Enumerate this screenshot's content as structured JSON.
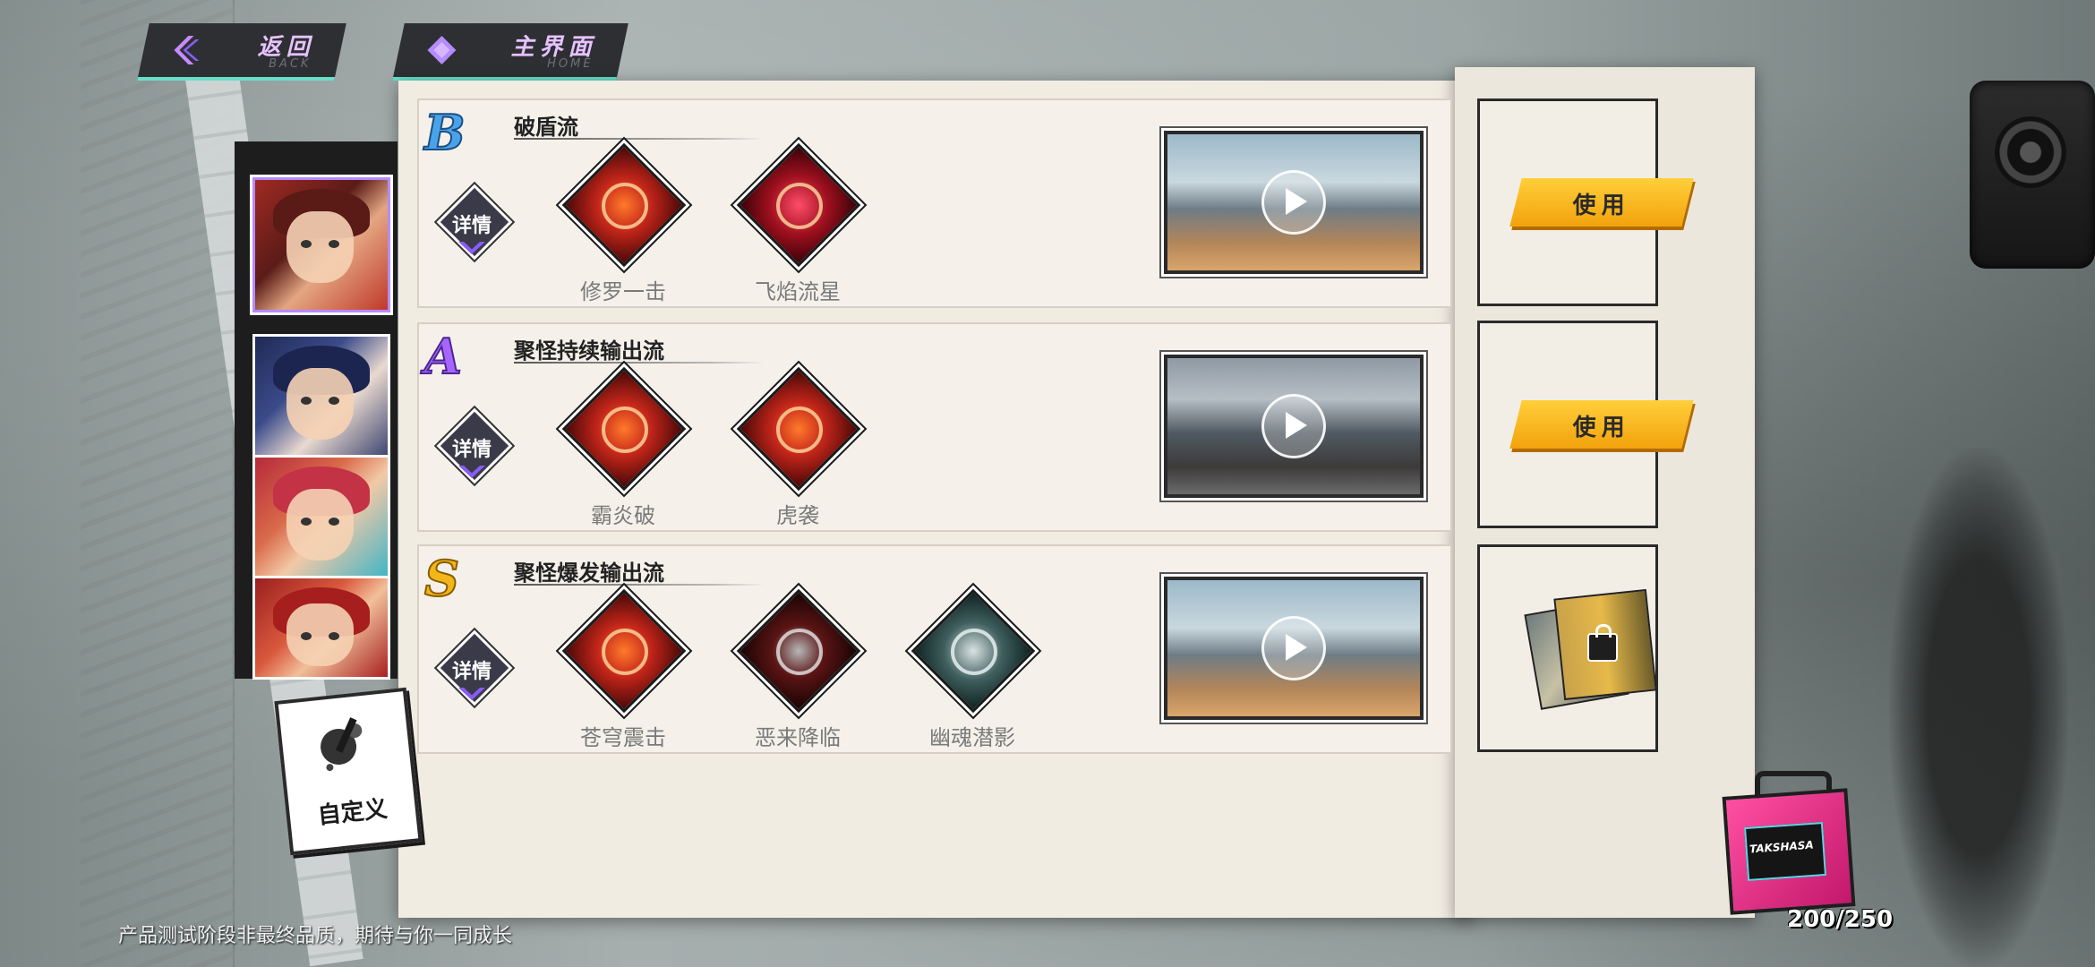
{
  "top_bar": {
    "back": {
      "label": "返回",
      "sub": "BACK"
    },
    "home": {
      "label": "主界面",
      "sub": "HOME"
    }
  },
  "custom_button": {
    "label": "自定义"
  },
  "builds": [
    {
      "rank": "B",
      "rank_color": "#4aa3e8",
      "title": "破盾流",
      "detail_label": "详情",
      "skills": [
        {
          "name": "修罗一击",
          "style": "red"
        },
        {
          "name": "飞焰流星",
          "style": "crimson"
        }
      ],
      "video": "sky",
      "slot_action": "使用"
    },
    {
      "rank": "A",
      "rank_color": "#a765ff",
      "title": "聚怪持续输出流",
      "detail_label": "详情",
      "skills": [
        {
          "name": "霸炎破",
          "style": "red"
        },
        {
          "name": "虎袭",
          "style": "red"
        }
      ],
      "video": "grey",
      "slot_action": "使用"
    },
    {
      "rank": "S",
      "rank_color": "#f2b51a",
      "title": "聚怪爆发输出流",
      "detail_label": "详情",
      "skills": [
        {
          "name": "苍穹震击",
          "style": "red"
        },
        {
          "name": "恶来降临",
          "style": "dark"
        },
        {
          "name": "幽魂潜影",
          "style": "teal"
        }
      ],
      "video": "sky",
      "slot_action": null
    }
  ],
  "storage": {
    "count": "200/250",
    "brand": "TAKSHASA"
  },
  "footer_note": "产品测试阶段非最终品质，期待与你一同成长",
  "colors": {
    "accent_purple": "#b58bff",
    "use_button": "#f2a20c",
    "teal_accent": "#66e0c8"
  },
  "icons": {
    "back": "chevron-left-icon",
    "home": "diamond-icon",
    "custom": "paint-brush-icon",
    "play": "play-icon",
    "lock": "lock-icon"
  }
}
